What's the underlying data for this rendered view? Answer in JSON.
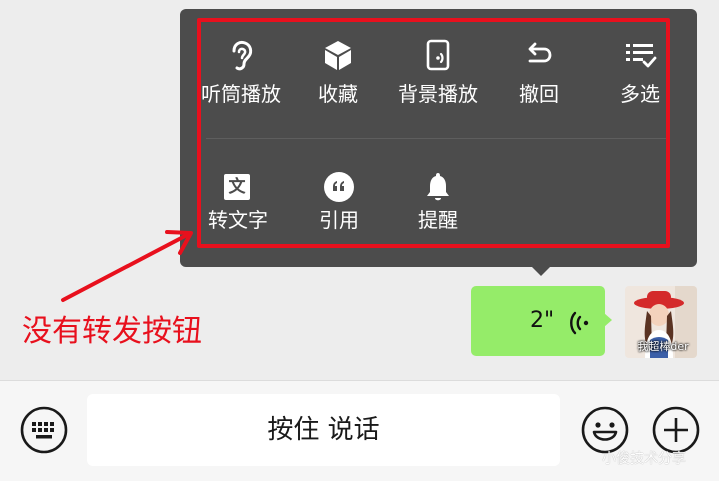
{
  "menu": {
    "row1": [
      {
        "label": "听筒播放",
        "icon": "ear-icon"
      },
      {
        "label": "收藏",
        "icon": "cube-icon"
      },
      {
        "label": "背景播放",
        "icon": "phone-audio-icon"
      },
      {
        "label": "撤回",
        "icon": "undo-icon"
      },
      {
        "label": "多选",
        "icon": "multi-select-icon"
      }
    ],
    "row2": [
      {
        "label": "转文字",
        "icon": "text-convert-icon",
        "glyph": "文"
      },
      {
        "label": "引用",
        "icon": "quote-icon"
      },
      {
        "label": "提醒",
        "icon": "bell-icon"
      }
    ]
  },
  "message": {
    "duration": "2\"",
    "avatar_caption": "我超棒der"
  },
  "annotation": {
    "text": "没有转发按钮",
    "color": "#e8101d"
  },
  "input_bar": {
    "hold_to_talk": "按住 说话"
  },
  "watermark": "小俊技术分享",
  "colors": {
    "menu_bg": "#4c4c4c",
    "bubble": "#95ec69",
    "highlight": "#e8101d"
  }
}
